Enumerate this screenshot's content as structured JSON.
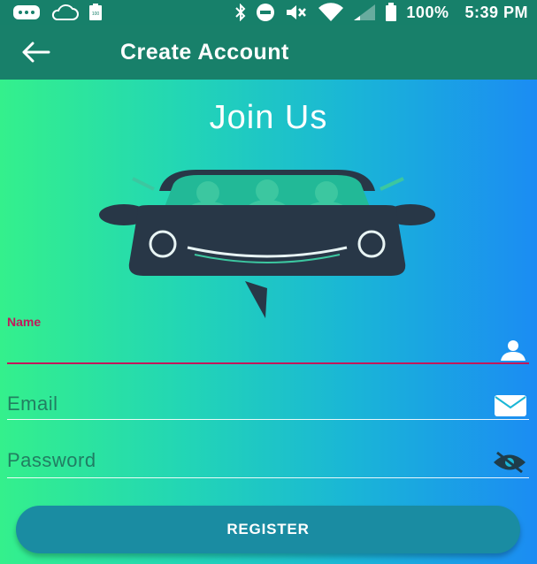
{
  "status_bar": {
    "battery_percent": "100%",
    "time": "5:39 PM",
    "battery_badge": "100",
    "icons": [
      "message-icon",
      "cloud-icon",
      "battery-small-icon",
      "bluetooth-icon",
      "do-not-disturb-icon",
      "vibrate-off-icon",
      "wifi-icon",
      "signal-icon",
      "battery-icon"
    ]
  },
  "app_bar": {
    "title": "Create Account",
    "back_icon": "arrow-left-icon"
  },
  "heading": "Join Us",
  "form": {
    "name": {
      "label": "Name",
      "value": "",
      "icon": "person-icon"
    },
    "email": {
      "placeholder": "Email",
      "value": "",
      "icon": "mail-icon"
    },
    "password": {
      "placeholder": "Password",
      "value": "",
      "icon": "eye-off-icon"
    }
  },
  "register_button": {
    "label": "REGISTER"
  },
  "colors": {
    "app_bar": "#18806a",
    "accent": "#c2185b",
    "button": "#1a8ca2",
    "logo_dark": "#283747",
    "logo_people": "#3cc7a0"
  }
}
